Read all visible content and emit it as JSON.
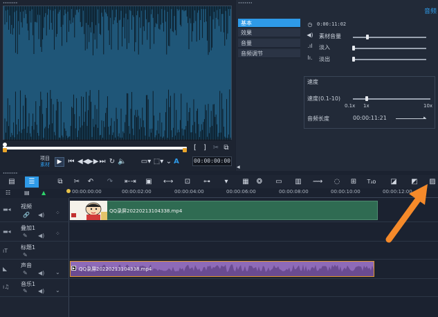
{
  "options": {
    "title": "音频",
    "tabs": [
      "基本",
      "效果",
      "音量",
      "音频调节"
    ],
    "duration": "0:00:11:02",
    "clip_volume_label": "素材音量",
    "fade_in_label": "淡入",
    "fade_out_label": "淡出",
    "speed_section_label": "速度",
    "speed_label": "速度(0.1-10)",
    "speed_ticks": [
      "0.1x",
      "1x",
      "10x"
    ],
    "audio_length_label": "音频长度",
    "audio_length_value": "00:00:11:21"
  },
  "preview": {
    "mode_project": "项目",
    "mode_clip": "素材",
    "timecode": "00:00:00:00",
    "bracket_in": "[",
    "bracket_out": "]",
    "text_a": "A"
  },
  "timeline": {
    "ruler": [
      "00:00:00:00",
      "00:00:02:00",
      "00:00:04:00",
      "00:00:06:00",
      "00:00:08:00",
      "00:00:10:00",
      "00:00:12:00"
    ],
    "tracks": {
      "video": "视频",
      "overlay": "叠加1",
      "title": "标题1",
      "voice": "声音",
      "music": "音乐1"
    },
    "video_clip_name": "QQ录屏20220213104338.mp4",
    "audio_clip_name": "QQ录屏20220213104338.mp4"
  },
  "colors": {
    "accent": "#2e9ae8",
    "arrow": "#f58a2a",
    "video_clip": "#2f6b52",
    "audio_clip": "#8e6ab8"
  }
}
